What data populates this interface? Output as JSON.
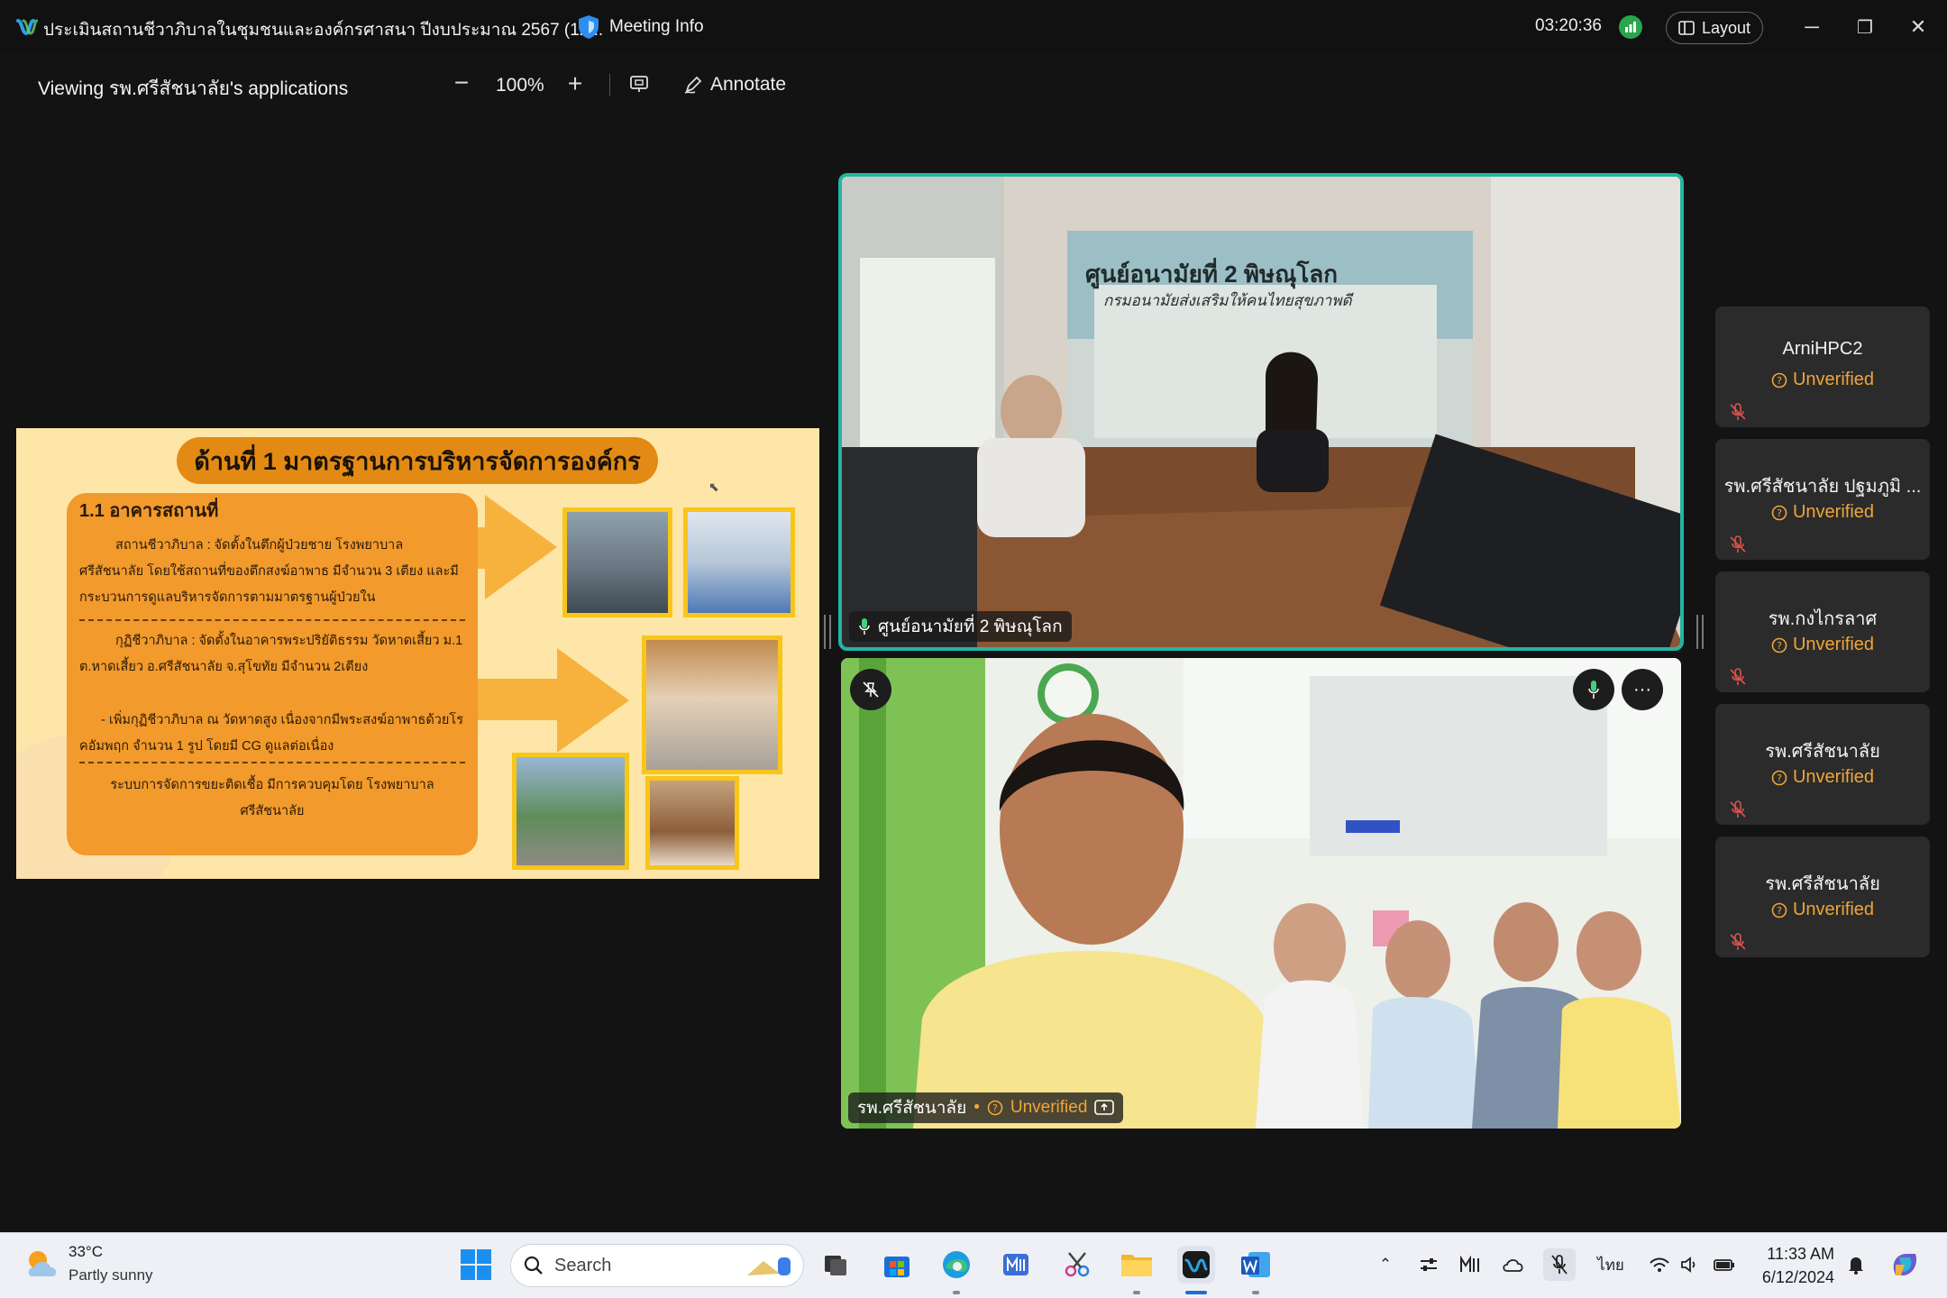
{
  "titlebar": {
    "meeting_title": "ประเมินสถานชีวาภิบาลในชุมชนและองค์กรศาสนา ปีงบประมาณ 2567 (12...",
    "meeting_info_label": "Meeting Info",
    "timer": "03:20:36",
    "layout_label": "Layout",
    "minimize": "─",
    "restore": "❐",
    "close": "✕"
  },
  "share_toolbar": {
    "viewing_label": "Viewing รพ.ศรีสัชนาลัย's applications",
    "zoom_minus": "−",
    "zoom_level": "100%",
    "zoom_plus": "+",
    "annotate_label": "Annotate"
  },
  "slide": {
    "title": "ด้านที่ 1 มาตรฐานการบริหารจัดการองค์กร",
    "subtitle": "1.1 อาคารสถานที่",
    "para1": "สถานชีวาภิบาล : จัดตั้งในตึกผู้ป่วยชาย โรงพยาบาลศรีสัชนาลัย โดยใช้สถานที่ของตึกสงฆ์อาพาธ มีจำนวน 3 เตียง และมีกระบวนการดูแลบริหารจัดการตามมาตรฐานผู้ป่วยใน",
    "para2": "กุฏิชีวาภิบาล : จัดตั้งในอาคารพระปริยัติธรรม วัดหาดเสี้ยว ม.1 ต.หาดเสี้ยว อ.ศรีสัชนาลัย จ.สุโขทัย มีจำนวน 2เตียง",
    "para3": "- เพิ่มกุฏิชีวาภิบาล ณ วัดหาดสูง เนื่องจากมีพระสงฆ์อาพาธด้วยโรคอัมพฤก จำนวน 1 รูป โดยมี CG ดูแลต่อเนื่อง",
    "para4": "ระบบการจัดการขยะติดเชื้อ มีการควบคุมโดย โรงพยาบาลศรีสัชนาลัย"
  },
  "video_main": {
    "name": "ศูนย์อนามัยที่ 2 พิษณุโลก",
    "banner_line1": "ศูนย์อนามัยที่ 2 พิษณุโลก",
    "banner_line2": "กรมอนามัยส่งเสริมให้คนไทยสุขภาพดี"
  },
  "video_second": {
    "name": "รพ.ศรีสัชนาลัย",
    "status": "Unverified",
    "more": "···"
  },
  "participants": [
    {
      "name": "ArniHPC2",
      "status": "Unverified"
    },
    {
      "name": "รพ.ศรีสัชนาลัย ปฐมภูมิ ...",
      "status": "Unverified"
    },
    {
      "name": "รพ.กงไกรลาศ",
      "status": "Unverified"
    },
    {
      "name": "รพ.ศรีสัชนาลัย",
      "status": "Unverified"
    },
    {
      "name": "รพ.ศรีสัชนาลัย",
      "status": "Unverified"
    }
  ],
  "taskbar": {
    "weather_temp": "33°C",
    "weather_desc": "Partly sunny",
    "search_placeholder": "Search",
    "language": "ไทย",
    "time": "11:33 AM",
    "date": "6/12/2024"
  },
  "colors": {
    "accent_border": "#22b5a4",
    "unverified": "#f0a43a",
    "signal": "#2ba44e",
    "slide_bg": "#fde6a8",
    "slide_card": "#f29a2c"
  }
}
